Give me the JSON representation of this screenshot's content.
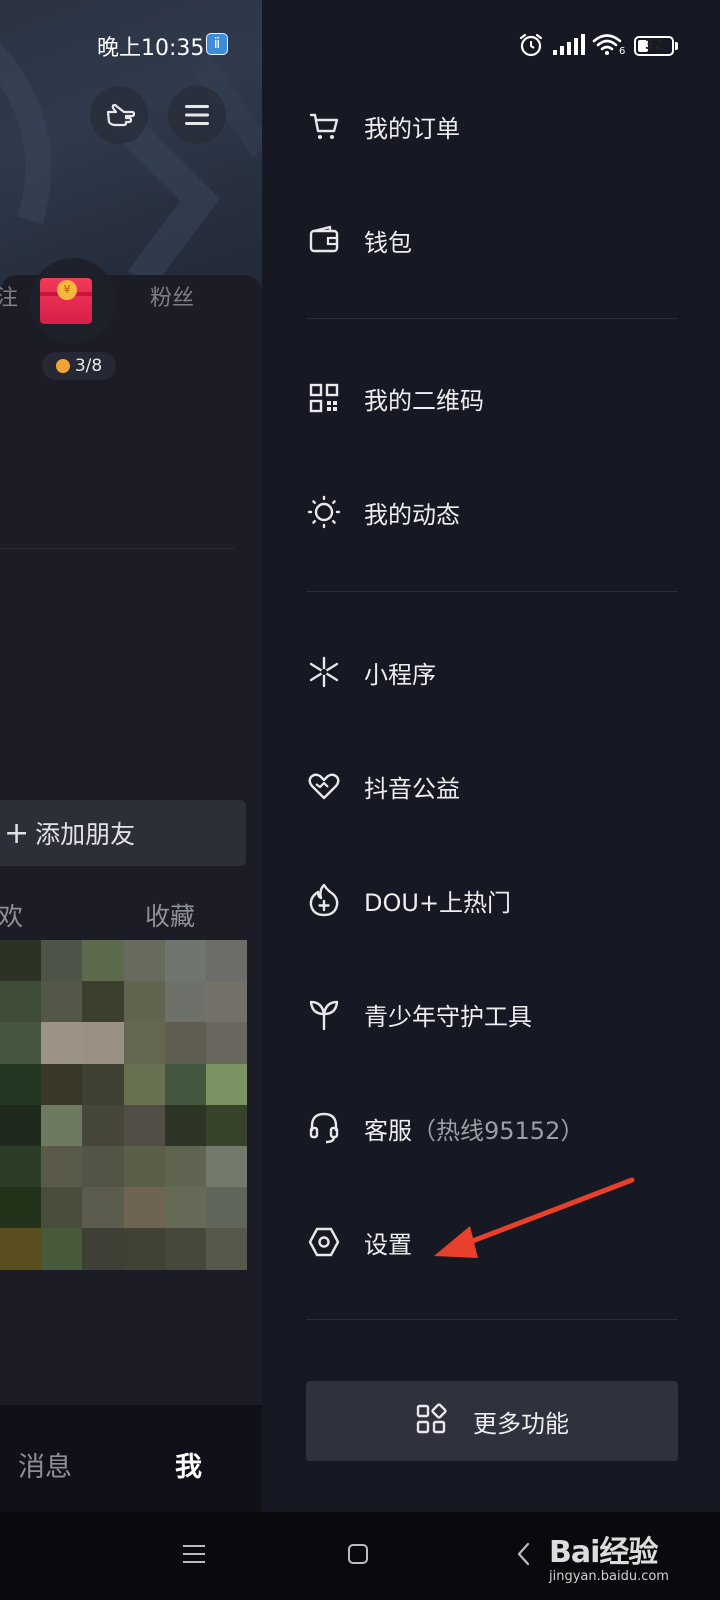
{
  "status_bar": {
    "time": "晚上10:35",
    "battery_percent": 32,
    "battery_label": "32",
    "wifi_label": "6"
  },
  "left_background": {
    "partial_tab_left": "注",
    "followers_label": "粉丝",
    "progress": "3/8",
    "add_friend_label": "添加朋友",
    "tab_likes_partial": "欢",
    "tab_favorites": "收藏",
    "bottom_nav": {
      "messages": "消息",
      "me": "我"
    }
  },
  "drawer": {
    "items": [
      {
        "label": "我的订单",
        "icon": "cart-icon"
      },
      {
        "label": "钱包",
        "icon": "wallet-icon"
      },
      {
        "label": "我的二维码",
        "icon": "qr-code-icon"
      },
      {
        "label": "我的动态",
        "icon": "activity-sun-icon"
      },
      {
        "label": "小程序",
        "icon": "mini-program-icon"
      },
      {
        "label": "抖音公益",
        "icon": "charity-heart-icon"
      },
      {
        "label": "DOU+上热门",
        "icon": "dou-plus-icon"
      },
      {
        "label": "青少年守护工具",
        "icon": "sprout-icon"
      },
      {
        "label": "客服",
        "sub": "（热线95152）",
        "icon": "headset-icon"
      },
      {
        "label": "设置",
        "icon": "settings-hexagon-icon"
      }
    ],
    "more_button": "更多功能"
  },
  "watermark": {
    "brand": "Bai经验",
    "url": "jingyan.baidu.com"
  },
  "colors": {
    "drawer_bg": "#161823",
    "arrow": "#e8402a",
    "more_button_bg": "#2f313c"
  }
}
